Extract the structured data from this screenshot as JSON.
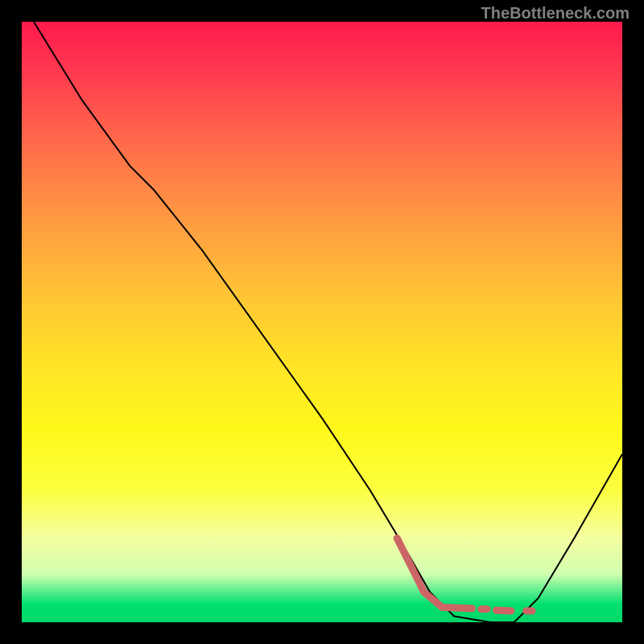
{
  "watermark": "TheBottleneck.com",
  "chart_data": {
    "type": "line",
    "title": "",
    "xlabel": "",
    "ylabel": "",
    "xlim": [
      0,
      100
    ],
    "ylim": [
      0,
      100
    ],
    "series": [
      {
        "name": "curve",
        "color": "#000000",
        "stroke_width": 2,
        "points": [
          {
            "x": 2,
            "y": 100
          },
          {
            "x": 10,
            "y": 87
          },
          {
            "x": 18,
            "y": 76
          },
          {
            "x": 22,
            "y": 72
          },
          {
            "x": 30,
            "y": 62
          },
          {
            "x": 40,
            "y": 48
          },
          {
            "x": 50,
            "y": 34
          },
          {
            "x": 58,
            "y": 22
          },
          {
            "x": 64,
            "y": 12
          },
          {
            "x": 68,
            "y": 5
          },
          {
            "x": 72,
            "y": 1
          },
          {
            "x": 78,
            "y": 0
          },
          {
            "x": 82,
            "y": 0
          },
          {
            "x": 86,
            "y": 4
          },
          {
            "x": 92,
            "y": 14
          },
          {
            "x": 100,
            "y": 28
          }
        ]
      },
      {
        "name": "highlight",
        "color": "#cc6666",
        "type": "segments",
        "stroke_width": 9,
        "segments": [
          {
            "x1": 62.5,
            "y1": 14,
            "x2": 67,
            "y2": 5
          },
          {
            "x1": 67,
            "y1": 5,
            "x2": 70,
            "y2": 2.5
          },
          {
            "x1": 70,
            "y1": 2.5,
            "x2": 75,
            "y2": 2.3
          },
          {
            "x1": 76.5,
            "y1": 2.2,
            "x2": 77.5,
            "y2": 2.2
          },
          {
            "x1": 79,
            "y1": 2.0,
            "x2": 81.5,
            "y2": 1.9
          },
          {
            "x1": 84,
            "y1": 1.9,
            "x2": 85,
            "y2": 1.9
          }
        ]
      }
    ],
    "gradient_background": {
      "type": "vertical",
      "stops": [
        {
          "pos": 0,
          "color": "#ff1a4d"
        },
        {
          "pos": 50,
          "color": "#ffd700"
        },
        {
          "pos": 97,
          "color": "#00e070"
        }
      ]
    }
  }
}
